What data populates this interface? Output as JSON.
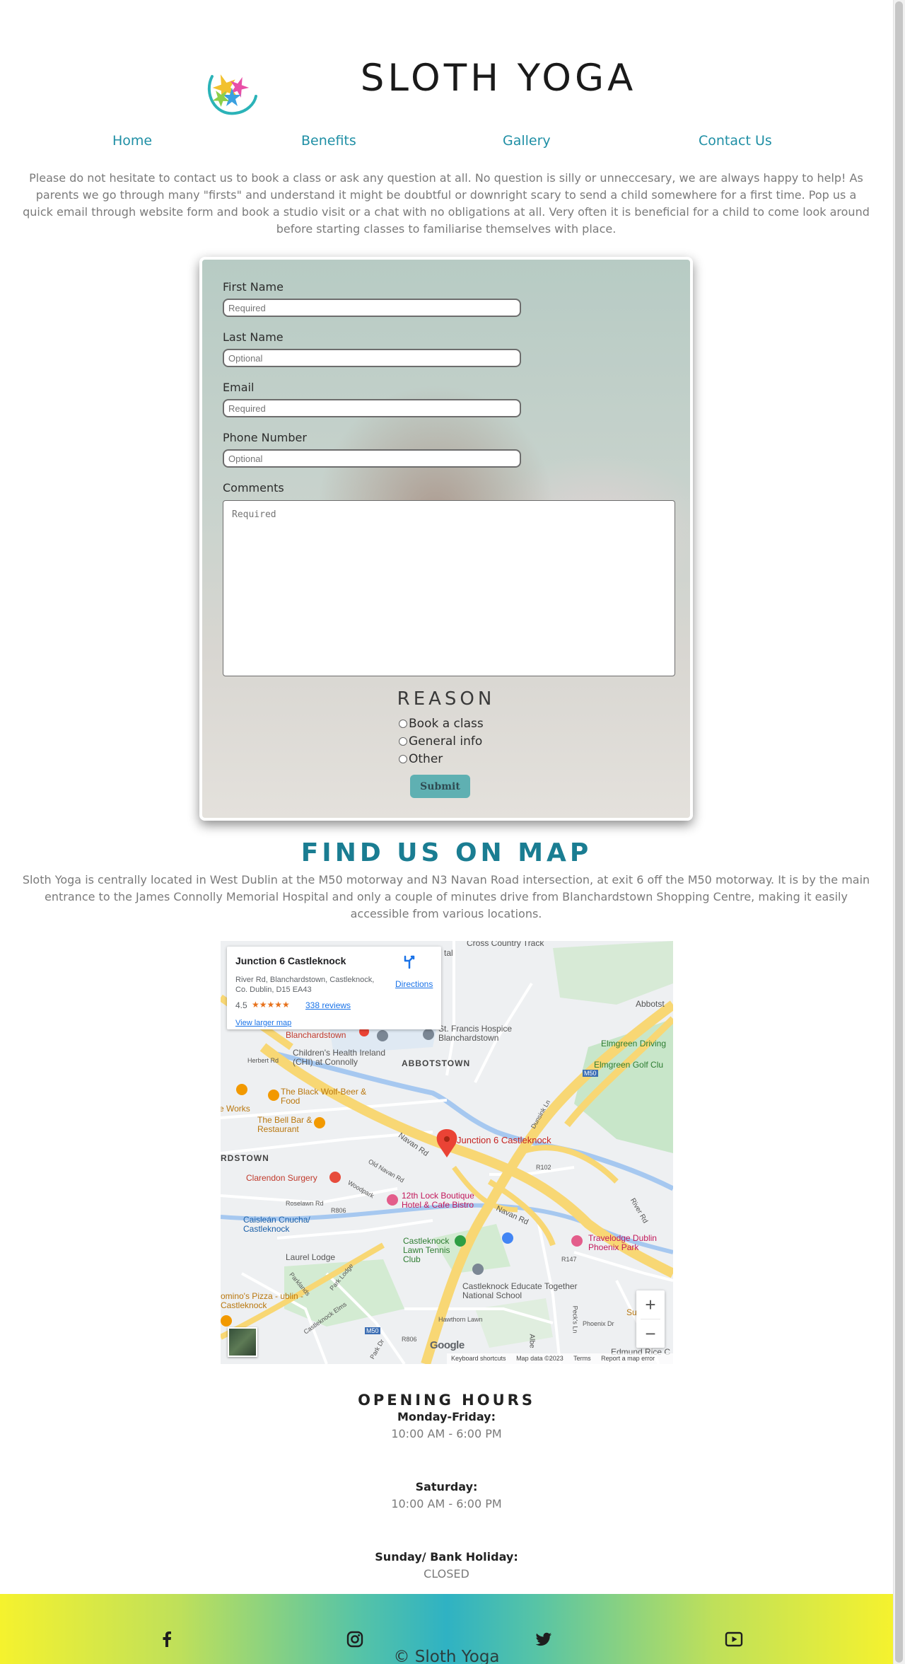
{
  "site": {
    "title": "SLOTH YOGA"
  },
  "nav": {
    "items": [
      "Home",
      "Benefits",
      "Gallery",
      "Contact Us"
    ]
  },
  "intro": {
    "text": "Please do not hesitate to contact us to book a class or ask any question at all. No question is silly or unneccesary, we are always happy to help! As parents we go through many \"firsts\" and understand it might be doubtful or downright scary to send a child somewhere for a first time. Pop us a quick email through website form and book a studio visit or a chat with no obligations at all. Very often it is beneficial for a child to come look around before starting classes to familiarise themselves with place."
  },
  "form": {
    "first_name_label": "First Name",
    "first_name_placeholder": "Required",
    "last_name_label": "Last Name",
    "last_name_placeholder": "Optional",
    "email_label": "Email",
    "email_placeholder": "Required",
    "phone_label": "Phone Number",
    "phone_placeholder": "Optional",
    "comments_label": "Comments",
    "comments_placeholder": "Required",
    "reason_title": "REASON",
    "reasons": [
      "Book a class",
      "General info",
      "Other"
    ],
    "submit_label": "Submit"
  },
  "map_section": {
    "heading": "FIND US ON MAP",
    "text": "Sloth Yoga is centrally located in West Dublin at the M50 motorway and N3 Navan Road intersection, at exit 6 off the M50 motorway. It is by the main entrance to the James Connolly Memorial Hospital and only a couple of minutes drive from Blanchardstown Shopping Centre, making it easily accessible from various locations."
  },
  "map": {
    "card": {
      "name": "Junction 6 Castleknock",
      "address": "River Rd, Blanchardstown, Castleknock, Co. Dublin, D15 EA43",
      "rating": "4.5",
      "stars": "★★★★★",
      "reviews": "338 reviews",
      "larger_map": "View larger map",
      "directions": "Directions"
    },
    "labels": {
      "marker": "Junction 6 Castleknock",
      "cross_country": "Cross Country Track",
      "tal": "tal",
      "abbotstown_top": "Abbotst",
      "st_francis": "St. Francis Hospice Blanchardstown",
      "elmgreen_driving": "Elmgreen Driving",
      "elmgreen_golf": "Elmgreen Golf Clu",
      "blanchardstown": "Blanchardstown",
      "childrens_health": "Children's Health Ireland (CHI) at Connolly",
      "abbotstown": "ABBOTSTOWN",
      "herbert_rd": "Herbert Rd",
      "black_wolf": "The Black Wolf-Beer & Food",
      "works": "e Works",
      "bell_bar": "The Bell Bar & Restaurant",
      "navan_rd_1": "Navan Rd",
      "navan_rd_2": "Navan Rd",
      "rdstown": "RDSTOWN",
      "old_navan": "Old Navan Rd",
      "r102": "R102",
      "dunsink": "Dunsink Ln",
      "clarendon": "Clarendon Surgery",
      "woodpark": "Woodpark",
      "lock_boutique": "12th Lock Boutique Hotel & Cafe Bistro",
      "roselawn": "Roselawn Rd",
      "r806_1": "R806",
      "river_rd": "River Rd",
      "caislean": "Caisleán Cnucha/ Castleknock",
      "castleknock_lawn": "Castleknock Lawn Tennis Club",
      "travelodge": "Travelodge Dublin Phoenix Park",
      "r147": "R147",
      "laurel_lodge": "Laurel Lodge",
      "park_lodge": "Park Lodge",
      "castleknock_educate": "Castleknock Educate Together National School",
      "parklands": "Parklands",
      "dominos": "omino's Pizza - ublin - Castleknock",
      "castleknock_elms": "Castleknock Elms",
      "hawthorn": "Hawthorn Lawn",
      "m50_1": "M50",
      "m50_2": "M50",
      "r806_2": "R806",
      "park_dr": "Park Dr",
      "albert": "Albe",
      "pecks": "Peck's Ln",
      "phoenix_dr": "Phoenix Dr",
      "su": "Su",
      "edmund": "Edmund Rice C"
    },
    "zoom_in": "+",
    "zoom_out": "−",
    "google": "Google",
    "footer": {
      "shortcuts": "Keyboard shortcuts",
      "map_data": "Map data ©2023",
      "terms": "Terms",
      "report": "Report a map error"
    }
  },
  "hours": {
    "title": "OPENING HOURS",
    "entries": [
      {
        "day": "Monday-Friday:",
        "time": "10:00 AM - 6:00 PM"
      },
      {
        "day": "Saturday:",
        "time": "10:00 AM - 6:00 PM"
      },
      {
        "day": "Sunday/ Bank Holiday:",
        "time": "CLOSED"
      }
    ]
  },
  "footer": {
    "copyright": "© Sloth Yoga",
    "social": [
      "facebook-icon",
      "instagram-icon",
      "twitter-icon",
      "youtube-icon"
    ]
  }
}
